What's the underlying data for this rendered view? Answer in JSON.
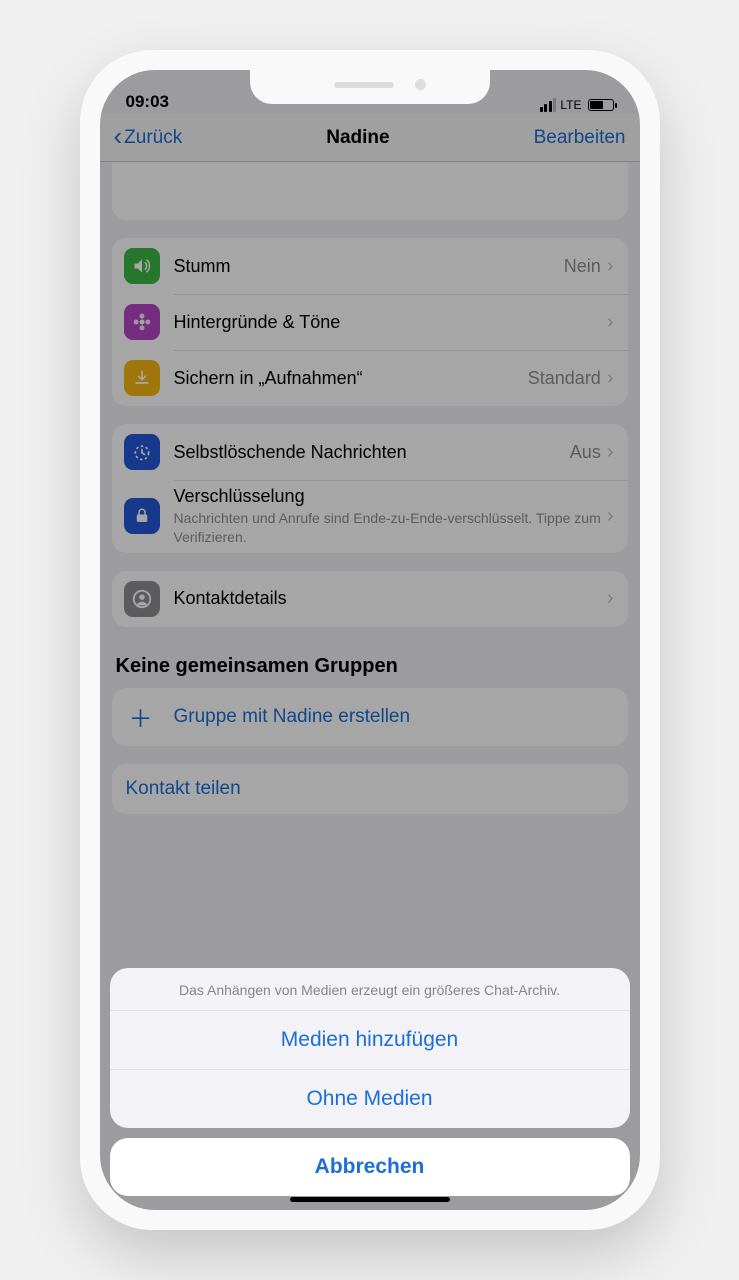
{
  "status": {
    "time": "09:03",
    "network": "LTE"
  },
  "nav": {
    "back": "Zurück",
    "title": "Nadine",
    "edit": "Bearbeiten"
  },
  "rows": {
    "mute": {
      "label": "Stumm",
      "value": "Nein"
    },
    "wallpaper": {
      "label": "Hintergründe & Töne"
    },
    "save": {
      "label": "Sichern in „Aufnahmen“",
      "value": "Standard"
    },
    "disappear": {
      "label": "Selbstlöschende Nachrichten",
      "value": "Aus"
    },
    "encryption": {
      "label": "Verschlüsselung",
      "sub": "Nachrichten und Anrufe sind Ende-zu-Ende-verschlüsselt. Tippe zum Verifizieren."
    },
    "contact": {
      "label": "Kontaktdetails"
    }
  },
  "sections": {
    "noGroups": "Keine gemeinsamen Gruppen",
    "createGroup": "Gruppe mit Nadine erstellen",
    "shareContact": "Kontakt teilen"
  },
  "sheet": {
    "message": "Das Anhängen von Medien erzeugt ein größeres Chat-Archiv.",
    "option1": "Medien hinzufügen",
    "option2": "Ohne Medien",
    "cancel": "Abbrechen"
  }
}
